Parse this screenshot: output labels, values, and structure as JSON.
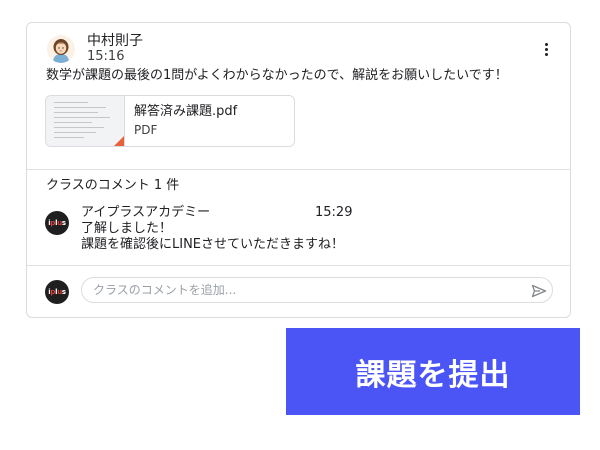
{
  "post": {
    "author": "中村則子",
    "time": "15:16",
    "body": "数学が課題の最後の1問がよくわからなかったので、解説をお願いしたいです！",
    "attachment": {
      "name": "解答済み課題.pdf",
      "type": "PDF"
    }
  },
  "comments": {
    "title": "クラスのコメント 1 件",
    "items": [
      {
        "author": "アイプラスアカデミー",
        "time": "15:29",
        "lines": [
          "了解しました！",
          "課題を確認後にLINEさせていただきますね！"
        ]
      }
    ]
  },
  "composer": {
    "placeholder": "クラスのコメントを追加..."
  },
  "submit": {
    "label": "課題を提出"
  },
  "colors": {
    "accent": "#4b54f5",
    "border": "#dadce0",
    "pdf_fold": "#e8613a"
  },
  "icons": {
    "more": "more-vert-icon",
    "send": "send-icon"
  }
}
